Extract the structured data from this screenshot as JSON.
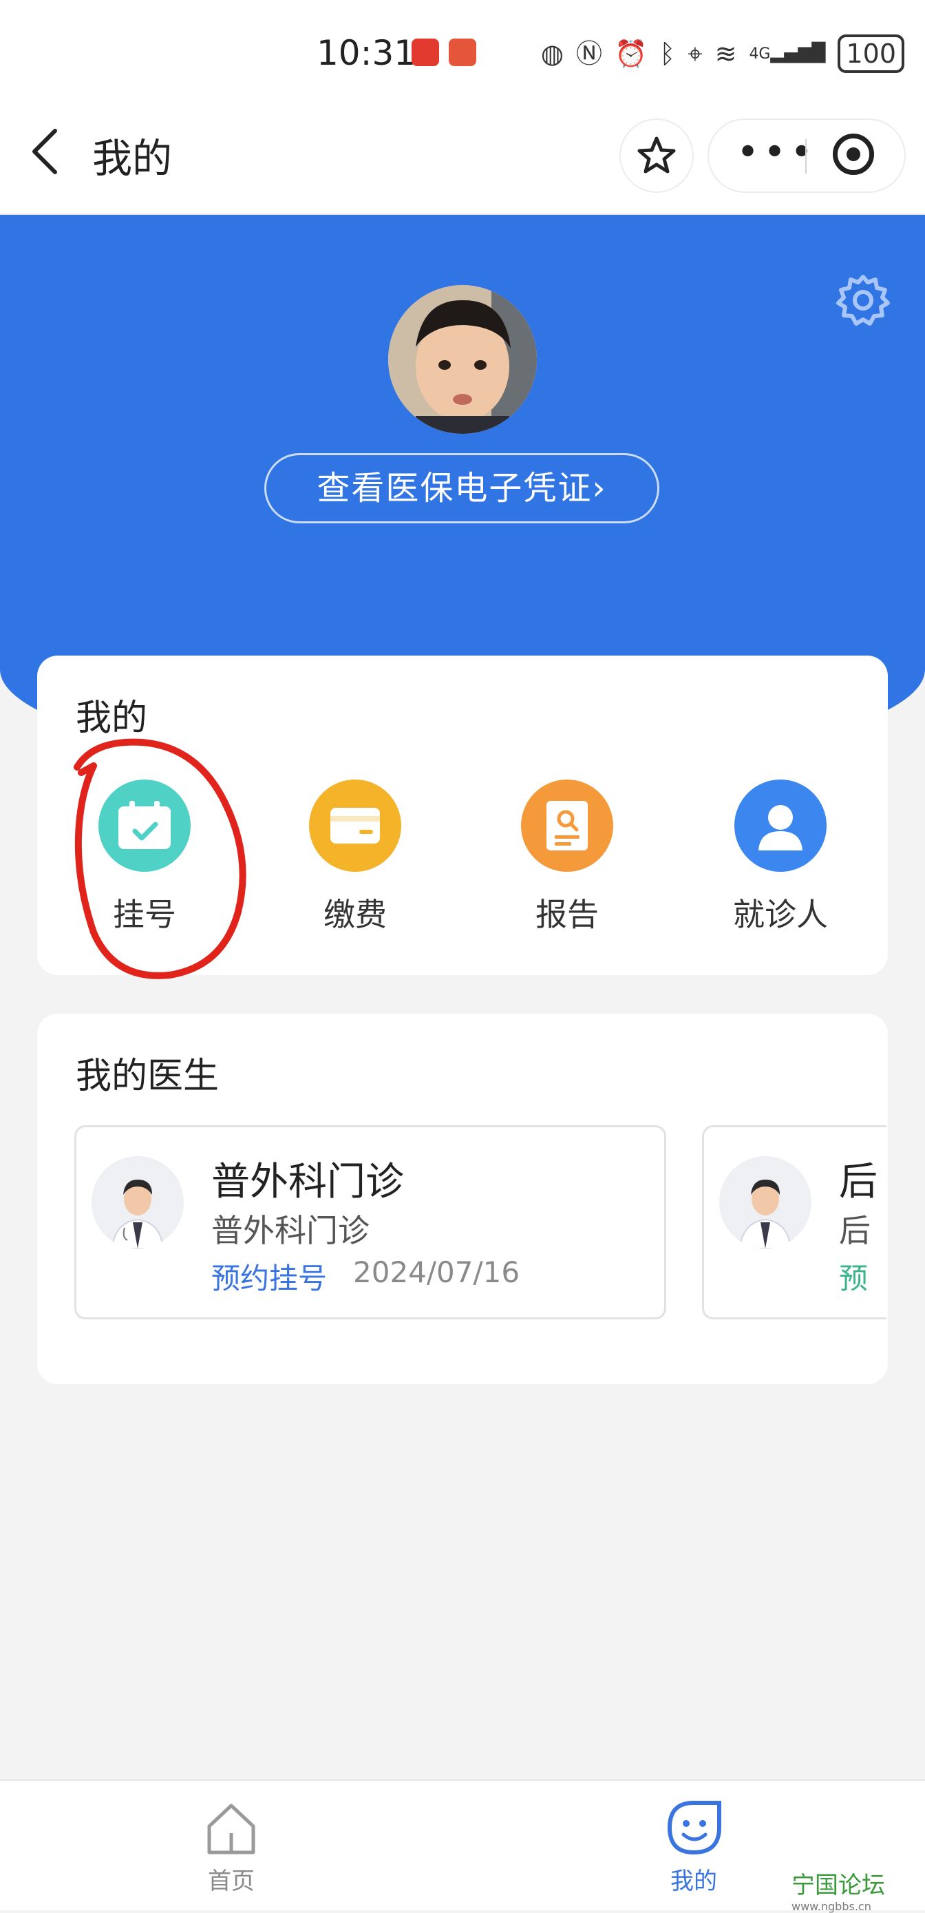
{
  "status_bar": {
    "time": "10:31",
    "battery": "100",
    "network": "4G"
  },
  "nav": {
    "title": "我的"
  },
  "profile": {
    "cert_button": "查看医保电子凭证›"
  },
  "mine_section": {
    "title": "我的",
    "items": [
      {
        "label": "挂号",
        "icon": "calendar-check-icon",
        "color": "#4fd1c5"
      },
      {
        "label": "缴费",
        "icon": "card-icon",
        "color": "#f5b32a"
      },
      {
        "label": "报告",
        "icon": "report-search-icon",
        "color": "#f49a3a"
      },
      {
        "label": "就诊人",
        "icon": "person-icon",
        "color": "#3c86f0"
      }
    ]
  },
  "doctors_section": {
    "title": "我的医生",
    "doctors": [
      {
        "name": "普外科门诊",
        "dept": "普外科门诊",
        "action": "预约挂号",
        "date": "2024/07/16"
      },
      {
        "name": "后",
        "dept": "后",
        "action": "预",
        "date": ""
      }
    ]
  },
  "tabbar": {
    "tabs": [
      {
        "label": "首页",
        "icon": "home-icon",
        "active": false
      },
      {
        "label": "我的",
        "icon": "smile-icon",
        "active": true
      }
    ]
  },
  "colors": {
    "accent": "#3174e4",
    "annotation": "#e0241b",
    "tab_active": "#3a74e0"
  },
  "watermark": {
    "text": "宁国论坛",
    "url": "www.ngbbs.cn"
  }
}
